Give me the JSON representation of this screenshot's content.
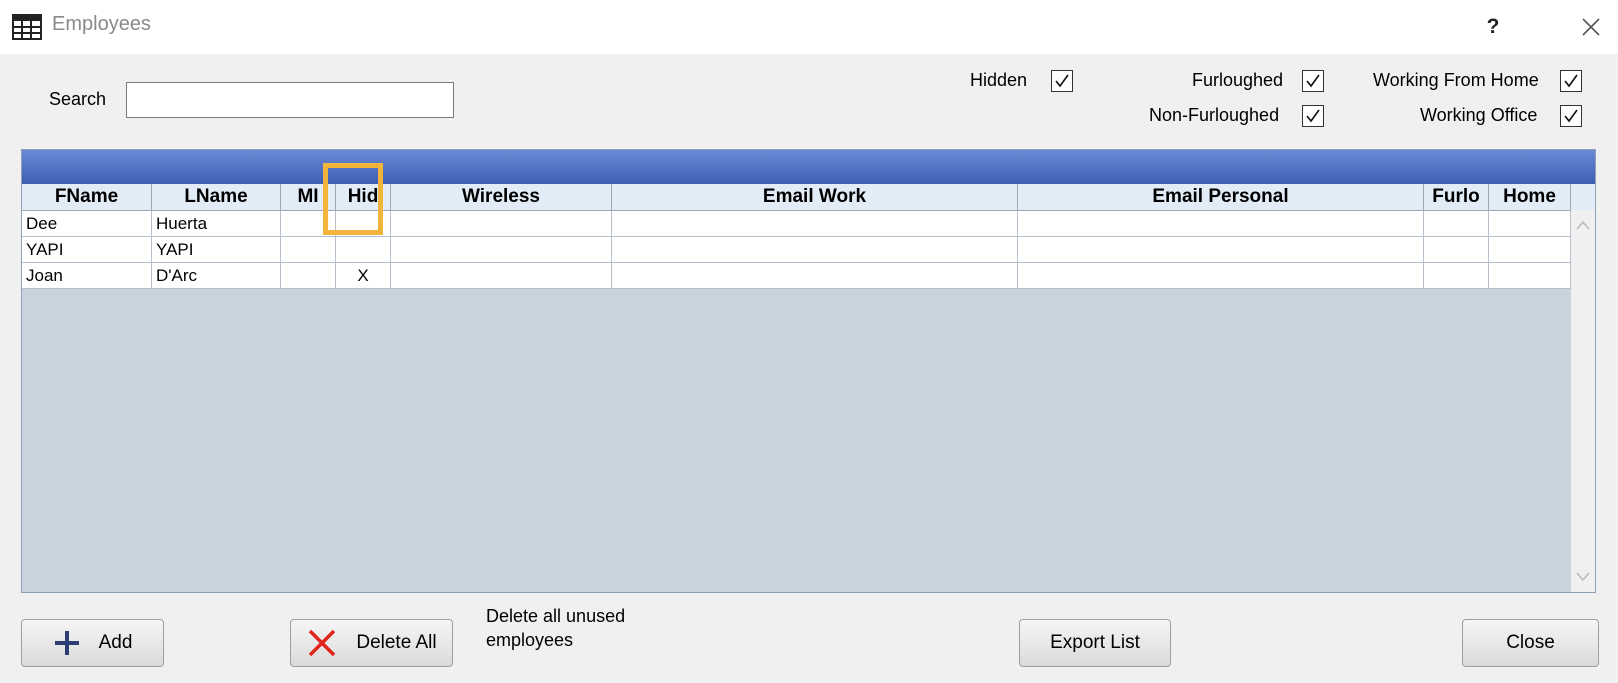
{
  "window": {
    "title": "Employees",
    "help_label": "?",
    "icon": "grid-table-icon"
  },
  "filters": {
    "search_label": "Search",
    "search_value": "",
    "hidden": {
      "label": "Hidden",
      "checked": true
    },
    "furloughed": {
      "label": "Furloughed",
      "checked": true
    },
    "non_furloughed": {
      "label": "Non-Furloughed",
      "checked": true
    },
    "working_from_home": {
      "label": "Working From Home",
      "checked": true
    },
    "working_office": {
      "label": "Working Office",
      "checked": true
    }
  },
  "table": {
    "columns": [
      "FName",
      "LName",
      "MI",
      "Hid",
      "Wireless",
      "Email Work",
      "Email Personal",
      "Furlo",
      "Home"
    ],
    "rows": [
      [
        "Dee",
        "Huerta",
        "",
        "",
        "",
        "",
        "",
        "",
        ""
      ],
      [
        "YAPI",
        "YAPI",
        "",
        "",
        "",
        "",
        "",
        "",
        ""
      ],
      [
        "Joan",
        "D'Arc",
        "",
        "X",
        "",
        "",
        "",
        "",
        ""
      ]
    ]
  },
  "buttons": {
    "add": "Add",
    "delete_all": "Delete All",
    "delete_note_line1": "Delete all unused",
    "delete_note_line2": "employees",
    "export": "Export List",
    "close": "Close"
  },
  "colors": {
    "grid_bar": "#3d5fb4",
    "grid_header": "#e2ecf7",
    "grid_empty": "#c9d3de",
    "highlight": "#f2b43a",
    "delete_icon": "#e0231b",
    "add_icon": "#2c3e73"
  }
}
